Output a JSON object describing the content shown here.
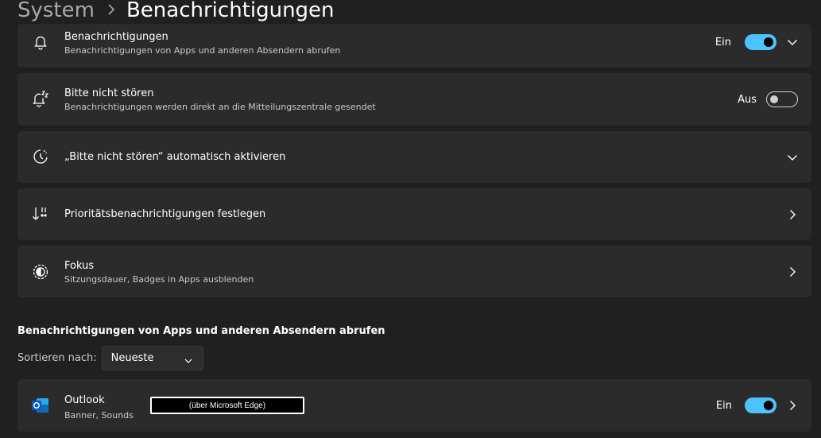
{
  "header": {
    "parent": "System",
    "separator": ">",
    "current": "Benachrichtigungen"
  },
  "settings": [
    {
      "icon": "bell-icon",
      "title": "Benachrichtigungen",
      "subtitle": "Benachrichtigungen von Apps und anderen Absendern abrufen",
      "state_label": "Ein",
      "toggle": "on",
      "trailing": "chevron-down-icon"
    },
    {
      "icon": "snooze-bell-icon",
      "title": "Bitte nicht stören",
      "subtitle": "Benachrichtigungen werden direkt an die Mitteilungszentrale gesendet",
      "state_label": "Aus",
      "toggle": "off"
    },
    {
      "icon": "clock-icon",
      "title": "„Bitte nicht stören“ automatisch aktivieren",
      "trailing": "chevron-down-icon"
    },
    {
      "icon": "priority-icon",
      "title": "Prioritätsbenachrichtigungen festlegen",
      "trailing": "chevron-right-icon"
    },
    {
      "icon": "focus-icon",
      "title": "Fokus",
      "subtitle": "Sitzungsdauer, Badges in Apps ausblenden",
      "trailing": "chevron-right-icon"
    }
  ],
  "apps_section": {
    "title": "Benachrichtigungen von Apps und anderen Absendern abrufen",
    "sort_label": "Sortieren nach:",
    "sort_value": "Neueste"
  },
  "apps": [
    {
      "icon": "outlook-icon",
      "name": "Outlook",
      "subtitle": "Banner, Sounds",
      "source_tag": "(über Microsoft Edge)",
      "state_label": "Ein",
      "toggle": "on"
    }
  ],
  "colors": {
    "background": "#202020",
    "card": "#2b2b2b",
    "accent": "#4cc2ff",
    "outlook_blue": "#0f6cbd"
  }
}
